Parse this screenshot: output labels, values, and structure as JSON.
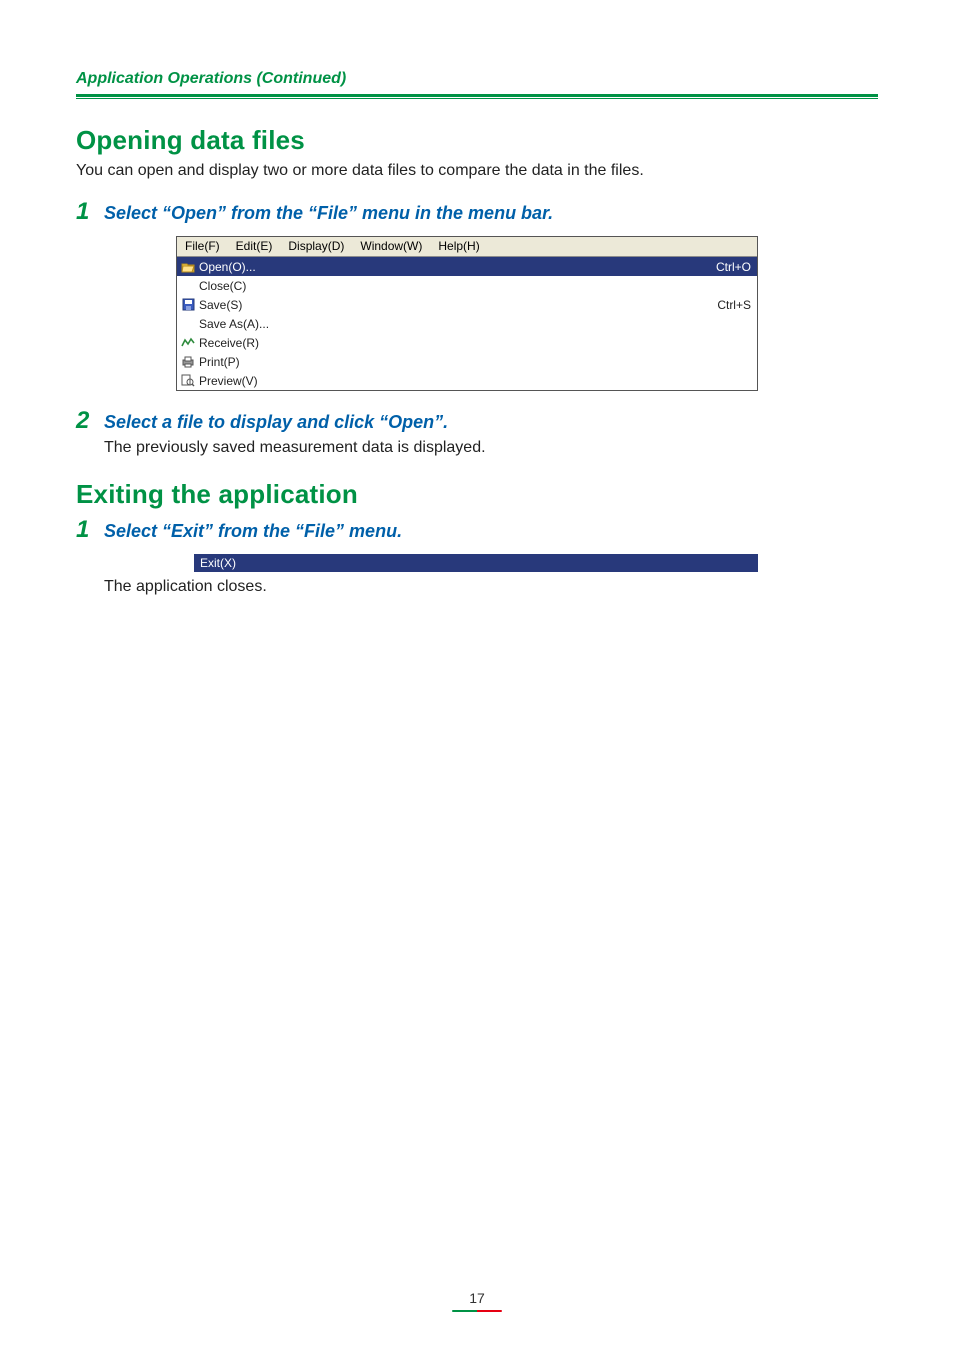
{
  "header": {
    "running": "Application Operations (Continued)"
  },
  "section1": {
    "title": "Opening data files",
    "intro": "You can open and display two or more data files to compare the data in the files.",
    "step1": {
      "num": "1",
      "text": "Select “Open” from the “File” menu in the menu bar."
    },
    "step2": {
      "num": "2",
      "text": "Select a file to display and click “Open”.",
      "note": "The previously saved measurement data is displayed."
    }
  },
  "screenshot1": {
    "menubar": [
      "File(F)",
      "Edit(E)",
      "Display(D)",
      "Window(W)",
      "Help(H)"
    ],
    "items": [
      {
        "icon": "open",
        "label": "Open(O)...",
        "shortcut": "Ctrl+O",
        "highlight": true
      },
      {
        "icon": "",
        "label": "Close(C)",
        "shortcut": "",
        "highlight": false
      },
      {
        "icon": "save",
        "label": "Save(S)",
        "shortcut": "Ctrl+S",
        "highlight": false
      },
      {
        "icon": "",
        "label": "Save As(A)...",
        "shortcut": "",
        "highlight": false
      },
      {
        "icon": "receive",
        "label": "Receive(R)",
        "shortcut": "",
        "highlight": false
      },
      {
        "icon": "print",
        "label": "Print(P)",
        "shortcut": "",
        "highlight": false
      },
      {
        "icon": "preview",
        "label": "Preview(V)",
        "shortcut": "",
        "highlight": false
      }
    ]
  },
  "section2": {
    "title": "Exiting the application",
    "step1": {
      "num": "1",
      "text": "Select “Exit” from the “File” menu."
    },
    "note": "The application closes."
  },
  "screenshot2": {
    "label": "Exit(X)"
  },
  "footer": {
    "page": "17"
  }
}
